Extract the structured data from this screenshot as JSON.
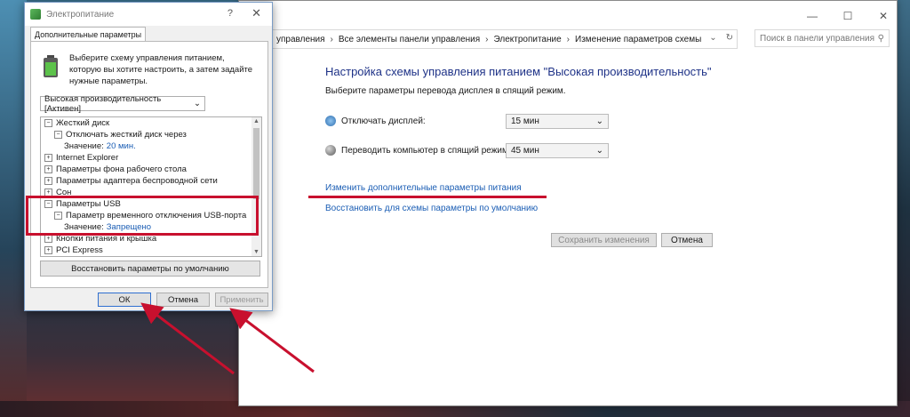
{
  "colors": {
    "accent": "#1e3287",
    "link": "#1a5db4",
    "annotation": "#c8102e"
  },
  "control_panel": {
    "window_buttons": [
      "—",
      "☐",
      "✕"
    ],
    "breadcrumbs": [
      "управления",
      "Все элементы панели управления",
      "Электропитание",
      "Изменение параметров схемы"
    ],
    "search_placeholder": "Поиск в панели управления",
    "heading": "Настройка схемы управления питанием \"Высокая производительность\"",
    "subheading": "Выберите параметры перевода дисплея в спящий режим.",
    "display_off_label": "Отключать дисплей:",
    "display_off_value": "15 мин",
    "sleep_label": "Переводить компьютер в спящий режим:",
    "sleep_value": "45 мин",
    "advanced_link": "Изменить дополнительные параметры питания",
    "restore_link": "Восстановить для схемы параметры по умолчанию",
    "save_button": "Сохранить изменения",
    "cancel_button": "Отмена"
  },
  "dialog": {
    "title": "Электропитание",
    "tab": "Дополнительные параметры",
    "description": "Выберите схему управления питанием, которую вы хотите настроить, а затем задайте нужные параметры.",
    "plan": "Высокая производительность [Активен]",
    "tree": [
      {
        "indent": 0,
        "expander": "−",
        "text": "Жесткий диск"
      },
      {
        "indent": 1,
        "expander": "−",
        "text": "Отключать жесткий диск через"
      },
      {
        "indent": 2,
        "label": "Значение:",
        "value": "20 мин."
      },
      {
        "indent": 0,
        "expander": "+",
        "text": "Internet Explorer"
      },
      {
        "indent": 0,
        "expander": "+",
        "text": "Параметры фона рабочего стола"
      },
      {
        "indent": 0,
        "expander": "+",
        "text": "Параметры адаптера беспроводной сети"
      },
      {
        "indent": 0,
        "expander": "+",
        "text": "Сон"
      },
      {
        "indent": 0,
        "expander": "−",
        "text": "Параметры USB"
      },
      {
        "indent": 1,
        "expander": "−",
        "text": "Параметр временного отключения USB-порта"
      },
      {
        "indent": 2,
        "label": "Значение:",
        "value": "Запрещено"
      },
      {
        "indent": 0,
        "expander": "+",
        "text": "Кнопки питания и крышка"
      },
      {
        "indent": 0,
        "expander": "+",
        "text": "PCI Express"
      }
    ],
    "restore_button": "Восстановить параметры по умолчанию",
    "ok_button": "ОК",
    "cancel_button": "Отмена",
    "apply_button": "Применить"
  }
}
